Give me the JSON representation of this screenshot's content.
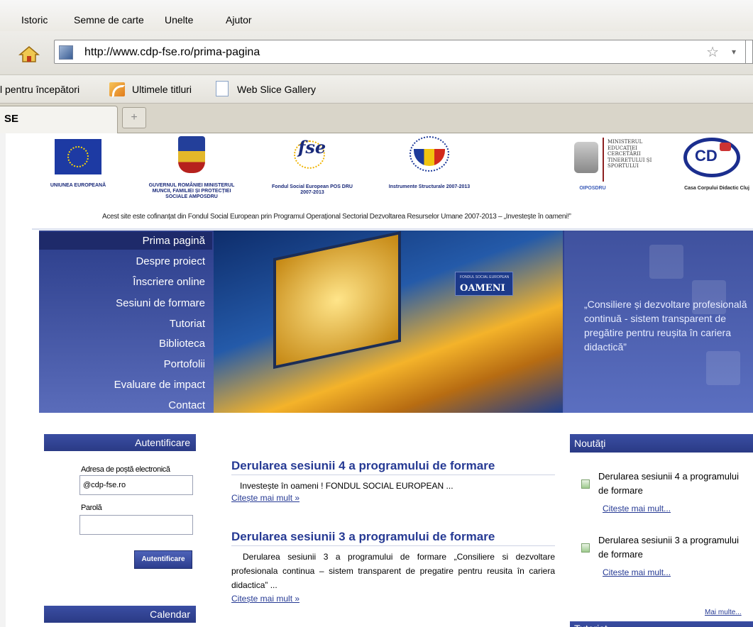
{
  "browser": {
    "menu": [
      "Istoric",
      "Semne de carte",
      "Unelte",
      "Ajutor"
    ],
    "url": "http://www.cdp-fse.ro/prima-pagina",
    "bookmarks": [
      "l pentru începători",
      "Ultimele titluri",
      "Web Slice Gallery"
    ],
    "tab_title": "SE",
    "new_tab_glyph": "+",
    "star_glyph": "☆",
    "drop_glyph": "▾"
  },
  "logos": {
    "eu": "UNIUNEA EUROPEANĂ",
    "gov": "GUVERNUL ROMÂNIEI MINISTERUL MUNCII, FAMILIEI ȘI PROTECȚIEI SOCIALE AMPOSDRU",
    "fse": "Fondul Social European POS DRU 2007-2013",
    "fse_mark": "fse",
    "is": "Instrumente Structurale 2007-2013",
    "ministry_text": "MINISTERUL EDUCAȚIEI CERCETĂRII TINERETULUI ȘI SPORTULUI",
    "oiposdru": "OIPOSDRU",
    "ccd": "Casa Corpului Didactic Cluj",
    "ccd_mark": "CD"
  },
  "tagline": "Acest site este cofinanțat din Fondul Social European prin Programul Operațional Sectorial Dezvoltarea Resurselor Umane 2007-2013 – „Investește în oameni!”",
  "nav": [
    "Prima pagină",
    "Despre proiect",
    "Înscriere online",
    "Sesiuni de formare",
    "Tutoriat",
    "Biblioteca",
    "Portofolii",
    "Evaluare de impact",
    "Contact"
  ],
  "banner": {
    "badge_small": "FONDUL SOCIAL EUROPEAN",
    "badge": "OAMENI",
    "quote": "„Consiliere și dezvoltare profesională continuă - sistem transparent de pregătire pentru reușita în cariera didactică”"
  },
  "login": {
    "heading": "Autentificare",
    "email_label": "Adresa de poștă electronică",
    "email_value": "@cdp-fse.ro",
    "password_label": "Parolă",
    "button": "Autentificare"
  },
  "calendar": {
    "heading": "Calendar"
  },
  "articles": [
    {
      "title": "Derularea sesiunii 4 a programului de formare",
      "excerpt": "Investește în oameni ! FONDUL SOCIAL EUROPEAN ...",
      "more": "Citește mai mult »"
    },
    {
      "title": "Derularea sesiunii 3 a programului de formare",
      "excerpt": "Derularea sesiunii 3 a programului de formare „Consiliere si dezvoltare profesionala continua – sistem transparent de pregatire pentru reusita în cariera didactica” ...",
      "more": "Citește mai mult »"
    }
  ],
  "news": {
    "heading": "Noutăți",
    "items": [
      {
        "title": "Derularea sesiunii 4 a programului de formare",
        "more": "Citeste mai mult..."
      },
      {
        "title": "Derularea sesiunii 3 a programului de formare",
        "more": "Citeste mai mult..."
      }
    ],
    "all_more": "Mai multe...",
    "next_heading": "Tutoriat"
  }
}
